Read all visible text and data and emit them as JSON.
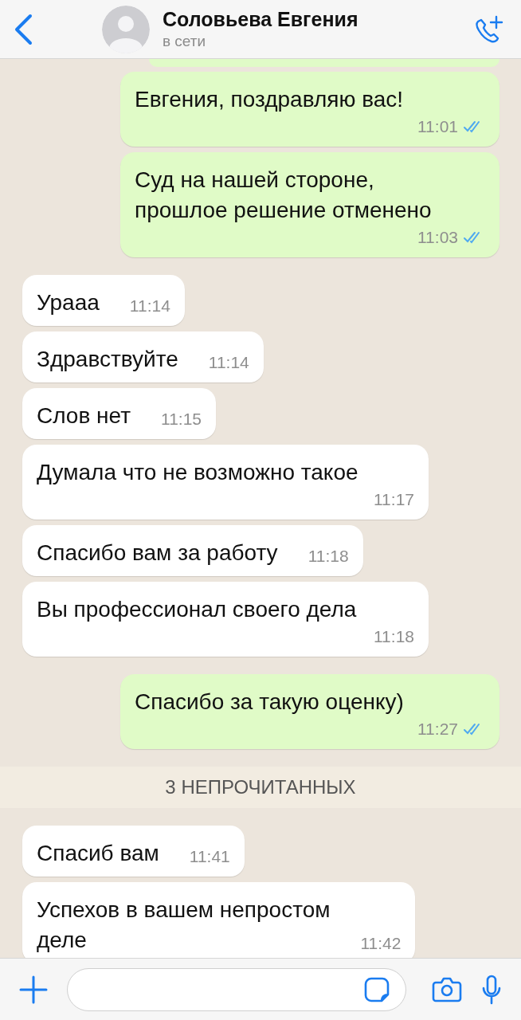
{
  "header": {
    "name": "Соловьева Евгения",
    "status": "в сети"
  },
  "messages": [
    {
      "kind": "out",
      "text": "Евгения, поздравляю вас!",
      "time": "11:01",
      "read": true
    },
    {
      "kind": "out",
      "text": "Суд на нашей стороне,\nпрошлое решение отменено",
      "time": "11:03",
      "read": true
    },
    {
      "kind": "in",
      "text": "Урааа",
      "time": "11:14"
    },
    {
      "kind": "in",
      "text": "Здравствуйте",
      "time": "11:14"
    },
    {
      "kind": "in",
      "text": "Слов нет",
      "time": "11:15"
    },
    {
      "kind": "in",
      "text": "Думала что не возможно такое",
      "time": "11:17"
    },
    {
      "kind": "in",
      "text": "Спасибо вам за работу",
      "time": "11:18"
    },
    {
      "kind": "in",
      "text": "Вы профессионал своего дела",
      "time": "11:18"
    },
    {
      "kind": "out",
      "text": "Спасибо за такую оценку)",
      "time": "11:27",
      "read": true
    },
    {
      "kind": "divider",
      "text": "3 НЕПРОЧИТАННЫХ"
    },
    {
      "kind": "in",
      "text": "Спасиб вам",
      "time": "11:41"
    },
    {
      "kind": "in",
      "text": "Успехов в вашем непростом\nделе",
      "time": "11:42"
    }
  ]
}
